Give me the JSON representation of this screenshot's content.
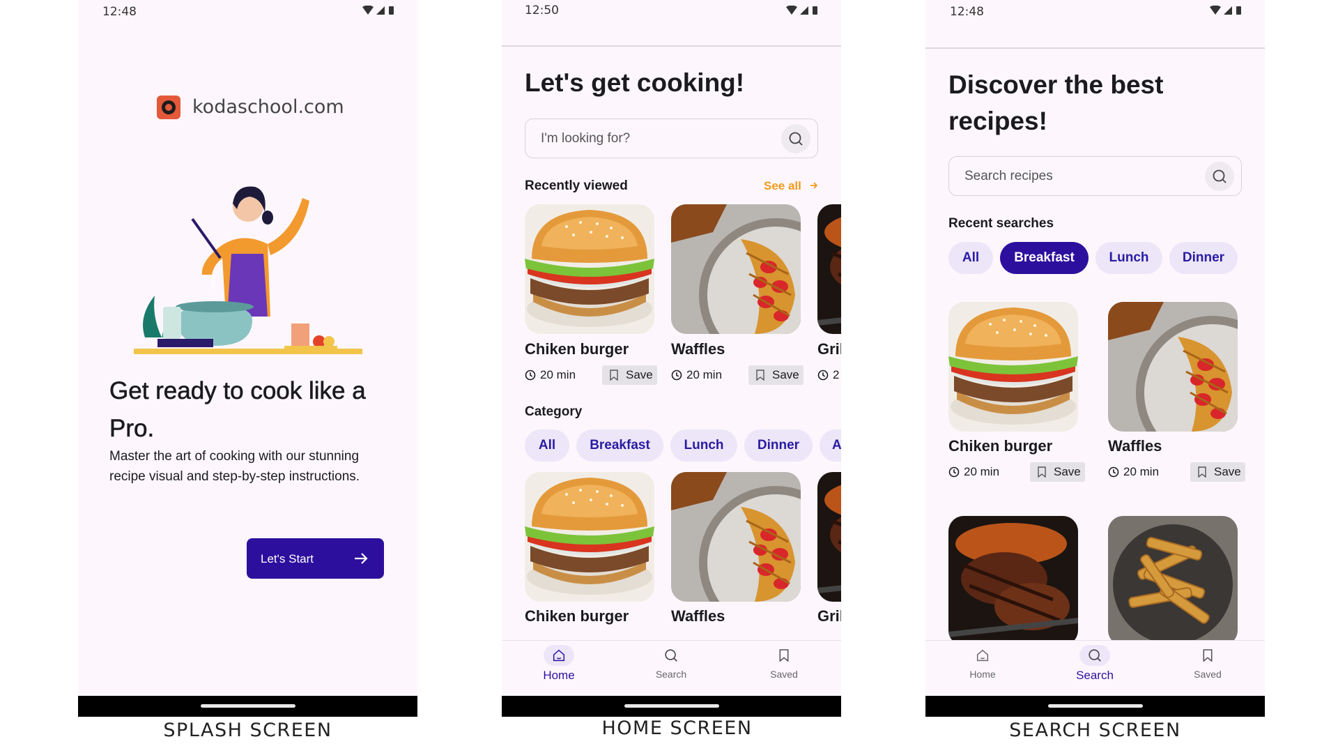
{
  "splash": {
    "status_time": "12:48",
    "brand": "kodaschool.com",
    "title": "Get ready to cook like a Pro.",
    "subtitle": "Master the art of cooking with our stunning recipe visual and step-by-step instructions.",
    "cta_label": "Let's Start",
    "caption": "SPLASH SCREEN"
  },
  "home": {
    "status_time": "12:50",
    "title": "Let's get cooking!",
    "search_placeholder": "I'm looking for?",
    "recently_viewed": "Recently viewed",
    "see_all": "See all",
    "category": "Category",
    "cards": [
      {
        "title": "Chiken burger",
        "time": "20 min",
        "save": "Save"
      },
      {
        "title": "Waffles",
        "time": "20 min",
        "save": "Save"
      },
      {
        "title": "Gril",
        "time": "2"
      }
    ],
    "categories": [
      "All",
      "Breakfast",
      "Lunch",
      "Dinner",
      "A"
    ],
    "cards2": [
      {
        "title": "Chiken burger"
      },
      {
        "title": "Waffles"
      },
      {
        "title": "Gril"
      }
    ],
    "nav": {
      "home": "Home",
      "search": "Search",
      "saved": "Saved"
    },
    "caption": "HOME SCREEN"
  },
  "search": {
    "status_time": "12:48",
    "title": "Discover the best recipes!",
    "search_placeholder": "Search recipes",
    "recent_searches": "Recent searches",
    "chips": [
      "All",
      "Breakfast",
      "Lunch",
      "Dinner"
    ],
    "selected_chip": "Breakfast",
    "cards": [
      {
        "title": "Chiken burger",
        "time": "20 min",
        "save": "Save"
      },
      {
        "title": "Waffles",
        "time": "20 min",
        "save": "Save"
      }
    ],
    "nav": {
      "home": "Home",
      "search": "Search",
      "saved": "Saved"
    },
    "caption": "SEARCH SCREEN"
  },
  "colors": {
    "primary": "#2d0f9e",
    "accent": "#f19a1c",
    "chip_bg": "#ece6f8",
    "screen_bg": "#fdf7fd"
  },
  "icons": [
    "wifi-icon",
    "signal-icon",
    "battery-icon",
    "search-icon",
    "clock-icon",
    "bookmark-icon",
    "home-icon",
    "arrow-right-icon"
  ]
}
